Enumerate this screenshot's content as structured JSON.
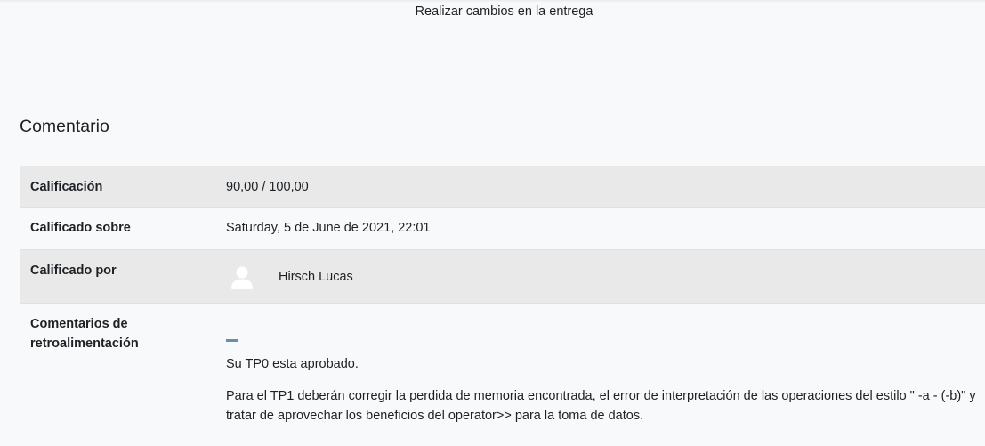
{
  "submission": {
    "edit_label": "Realizar cambios en la entrega"
  },
  "feedback": {
    "title": "Comentario",
    "rows": {
      "grade": {
        "label": "Calificación",
        "value": "90,00 / 100,00"
      },
      "graded_on": {
        "label": "Calificado sobre",
        "value": "Saturday, 5 de June de 2021, 22:01"
      },
      "graded_by": {
        "label": "Calificado por",
        "name": "Hirsch Lucas"
      },
      "comments": {
        "label": "Comentarios de retroalimentación",
        "paragraphs": [
          "Su TP0 esta aprobado.",
          "Para el TP1 deberán corregir la perdida de memoria encontrada, el error de interpretación de las operaciones del estilo \" -a - (-b)\" y tratar de aprovechar los beneficios del operator>> para la toma de datos."
        ]
      }
    }
  },
  "colors": {
    "background": "#f8f9fa",
    "shaded_row": "#e9e9e9",
    "border": "#dee2e6",
    "toggle": "#6a8fa6"
  },
  "icons": {
    "avatar": "user-avatar-icon",
    "toggle": "collapse-icon"
  }
}
